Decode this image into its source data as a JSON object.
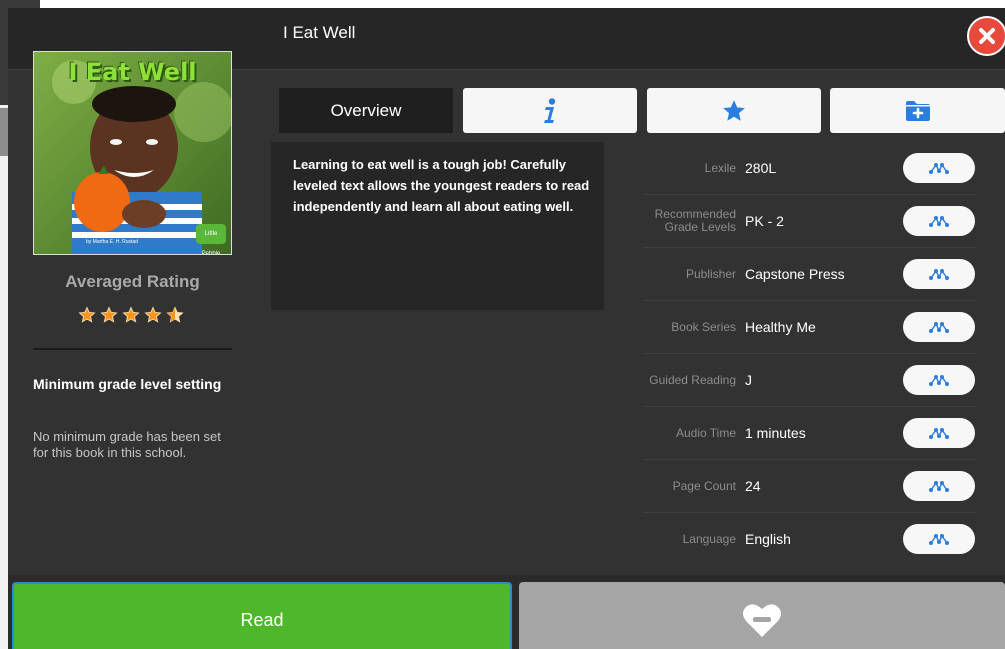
{
  "header": {
    "title": "I Eat Well"
  },
  "cover": {
    "title": "I Eat Well",
    "author": "by Martha E. H. Rustad",
    "badge": "Little Pebble"
  },
  "rating": {
    "label": "Averaged Rating",
    "value": 4.5,
    "max": 5
  },
  "min_grade": {
    "title": "Minimum grade level setting",
    "text": "No minimum grade has been set for this book in this school."
  },
  "tabs": {
    "overview_label": "Overview",
    "info_icon": "info-icon",
    "star_icon": "star-icon",
    "folder_icon": "folder-plus-icon"
  },
  "description": "Learning to eat well is a tough job! Carefully leveled text allows the youngest readers to read independently and learn all about eating well.",
  "details": [
    {
      "key": "Lexile",
      "value": "280L"
    },
    {
      "key": "Recommended Grade Levels",
      "value": "PK - 2"
    },
    {
      "key": "Publisher",
      "value": "Capstone Press"
    },
    {
      "key": "Book Series",
      "value": "Healthy Me"
    },
    {
      "key": "Guided Reading",
      "value": "J"
    },
    {
      "key": "Audio Time",
      "value": "1 minutes"
    },
    {
      "key": "Page Count",
      "value": "24"
    },
    {
      "key": "Language",
      "value": "English"
    }
  ],
  "actions": {
    "read_label": "Read",
    "favorite_icon": "heart-minus-icon"
  },
  "colors": {
    "accent_green": "#4fb82a",
    "close_red": "#e7493c",
    "icon_blue": "#2a7ee0",
    "star_orange": "#f5951f"
  }
}
